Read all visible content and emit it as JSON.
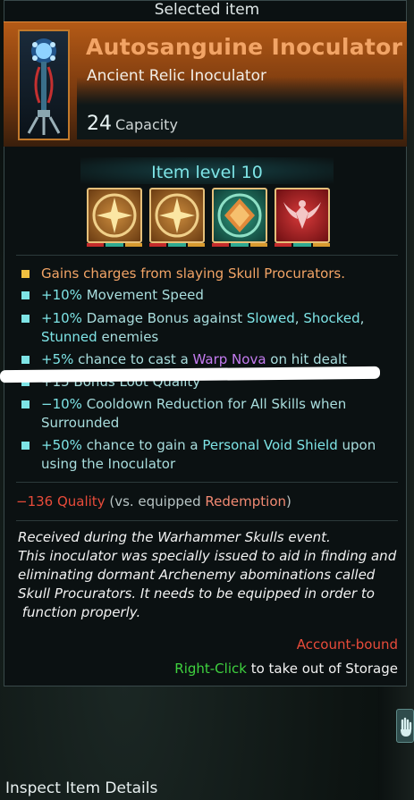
{
  "panel_title": "Selected item",
  "item": {
    "name": "Autosanguine Inoculator",
    "type": "Ancient Relic Inoculator",
    "capacity_value": "24",
    "capacity_label": "Capacity",
    "level_label": "Item level 10"
  },
  "modifiers": [
    {
      "icon": "sunburst-icon"
    },
    {
      "icon": "sunburst-icon"
    },
    {
      "icon": "diamond-shield-icon"
    },
    {
      "icon": "winged-emblem-icon"
    }
  ],
  "stats": {
    "s1": {
      "text": "Gains charges from slaying Skull Procurators."
    },
    "s2": {
      "value": "+10%",
      "text": " Movement Speed"
    },
    "s3": {
      "value": "+10%",
      "text": " Damage Bonus against ",
      "k1": "Slowed",
      "sep1": ", ",
      "k2": "Shocked",
      "sep2": ",",
      "k3": "Stunned",
      "tail": " enemies"
    },
    "s4": {
      "value": "+5%",
      "text": " chance to cast a ",
      "k1": "Warp Nova",
      "tail": " on hit dealt"
    },
    "s5": {
      "text": "+15 Bonus Loot Quality"
    },
    "s6": {
      "value": "−10%",
      "text": " Cooldown Reduction for All Skills when",
      "line2": "Surrounded"
    },
    "s7": {
      "value": "+50%",
      "text": " chance to gain a ",
      "k1": "Personal Void Shield",
      "tail": " upon",
      "line2": "using the Inoculator"
    }
  },
  "quality": {
    "value": "−136 Quality",
    "prefix": " (vs. equipped ",
    "equipped": "Redemption",
    "suffix": ")"
  },
  "lore": [
    "Received during the Warhammer Skulls event.",
    "This inoculator was specially issued to aid in finding and",
    "eliminating dormant Archenemy abominations called",
    "Skull Procurators. It needs to be equipped in order to",
    " function properly."
  ],
  "binding": "Account-bound",
  "action": {
    "key": "Right-Click",
    "text": " to take out of Storage"
  },
  "footer": "Inspect Item Details",
  "colors": {
    "header_orange": "#b45a16",
    "name_orange": "#f2a466",
    "teal": "#7ee4e6",
    "purple": "#c47cf0",
    "red": "#e84b3a",
    "green": "#3fd23f"
  }
}
